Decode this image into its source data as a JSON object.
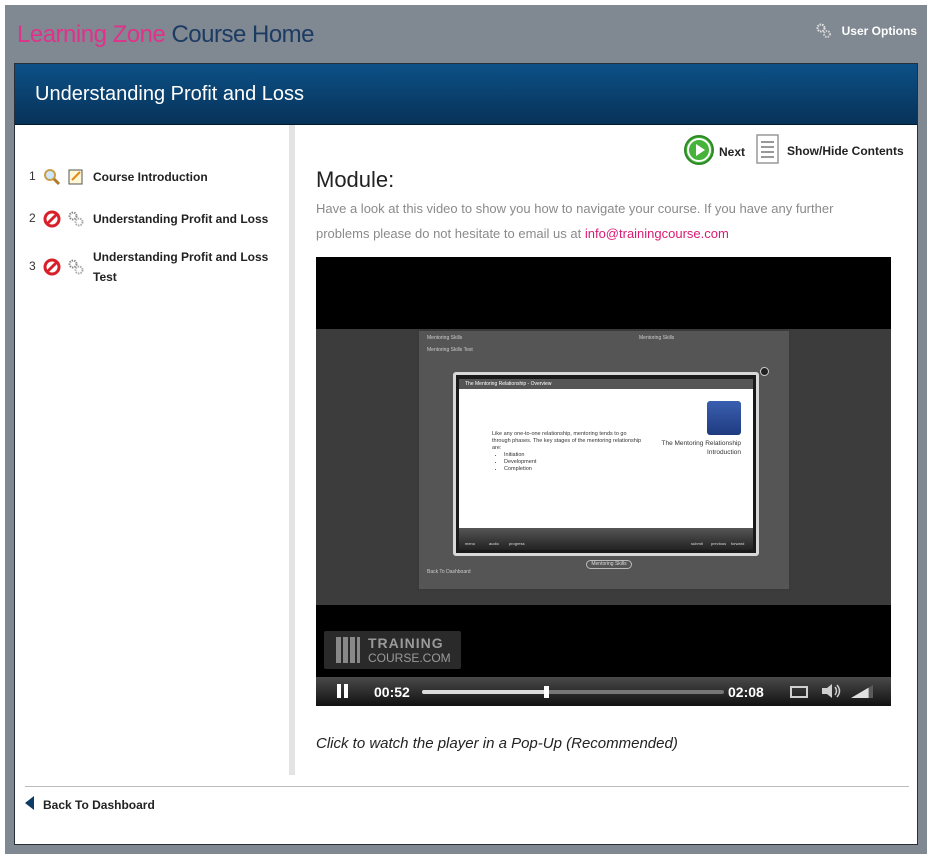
{
  "brand": {
    "part1": "Learning Zone",
    "part2": "Course Home"
  },
  "header": {
    "user_options_label": "User Options",
    "user_options_icon": "gears-icon"
  },
  "course": {
    "title": "Understanding Profit and Loss"
  },
  "toc": {
    "items": [
      {
        "num": "1",
        "label": "Course Introduction",
        "icons": [
          "magnifier-icon",
          "notepad-icon"
        ]
      },
      {
        "num": "2",
        "label": "Understanding Profit and Loss",
        "icons": [
          "no-entry-icon",
          "gears-icon"
        ]
      },
      {
        "num": "3",
        "label": "Understanding Profit and Loss Test",
        "icons": [
          "no-entry-icon",
          "gears-icon"
        ]
      }
    ]
  },
  "nav": {
    "next_label": "Next",
    "toggle_label": "Show/Hide Contents"
  },
  "module": {
    "heading": "Module:",
    "description": "Have a look at this video to show you how to navigate your course.  If you have any further problems please do not hesitate to email us at",
    "email": "info@trainingcourse.com"
  },
  "video": {
    "inner_sidebar": [
      "Mentoring Skills",
      "Mentoring Skills Test"
    ],
    "inner_title": "Mentoring Skills",
    "modal_title": "The Mentoring Relationship - Overview",
    "modal_text": "Like any one-to-one relationship, mentoring tends to go through phases. The key stages of the mentoring relationship are:",
    "modal_bullets": [
      "Initiation",
      "Development",
      "Completion"
    ],
    "modal_right": "The Mentoring Relationship",
    "modal_right_sub": "Introduction",
    "modal_controls": [
      "menu",
      "audio",
      "progress",
      "submit",
      "previous",
      "forward"
    ],
    "stage_label": "Mentoring Skills",
    "stage_back": "Back To Dashboard",
    "watermark_line1": "TRAINING",
    "watermark_line2": "COURSE.COM",
    "time_elapsed": "00:52",
    "time_total": "02:08",
    "progress": 0.412,
    "volume": 0.8
  },
  "popup_link": "Click to watch the player in a Pop-Up (Recommended)",
  "footer": {
    "back_label": "Back To Dashboard"
  },
  "colors": {
    "brand_pink": "#e0328a",
    "brand_navy": "#1c3b63",
    "title_bar": "#0a4474",
    "link_pink": "#d91a74",
    "next_green": "#46b33a"
  }
}
